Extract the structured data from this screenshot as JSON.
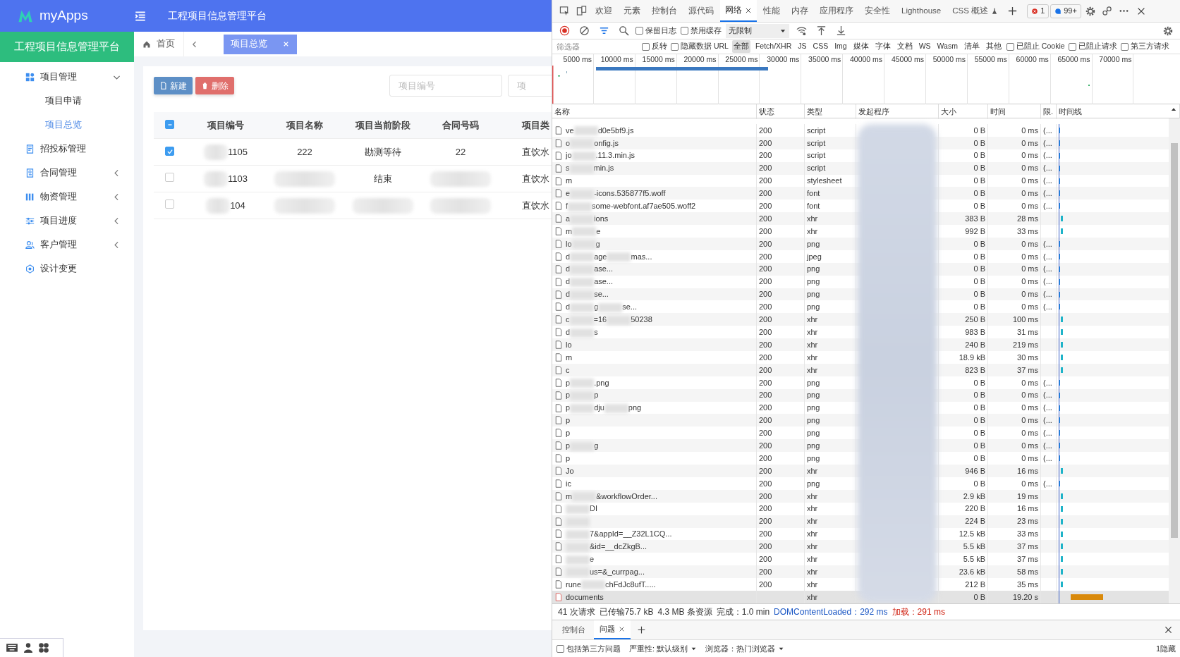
{
  "app": {
    "logo": "myApps",
    "header_title": "工程项目信息管理平台",
    "brand": "工程项目信息管理平台",
    "sidebar": [
      {
        "label": "项目管理",
        "kind": "group",
        "expanded": true,
        "children": [
          {
            "label": "项目申请",
            "selected": false
          },
          {
            "label": "项目总览",
            "selected": true
          }
        ]
      },
      {
        "label": "招投标管理",
        "kind": "link"
      },
      {
        "label": "合同管理",
        "kind": "group",
        "expanded": false
      },
      {
        "label": "物资管理",
        "kind": "group",
        "expanded": false
      },
      {
        "label": "项目进度",
        "kind": "group",
        "expanded": false
      },
      {
        "label": "客户管理",
        "kind": "group",
        "expanded": false
      },
      {
        "label": "设计变更",
        "kind": "link"
      }
    ],
    "tabs": [
      {
        "label": "首页",
        "kind": "home",
        "selected": false
      },
      {
        "label": "项目总览",
        "kind": "closable",
        "selected": true
      }
    ],
    "buttons": [
      {
        "label": "新建",
        "kind": "primary"
      },
      {
        "label": "删除",
        "kind": "danger"
      }
    ],
    "search_fields": [
      {
        "placeholder": "项目编号"
      },
      {
        "placeholder": "项"
      }
    ],
    "table": {
      "header_check": {
        "checked": true,
        "partial": true
      },
      "columns": [
        "项目编号",
        "项目名称",
        "项目当前阶段",
        "合同号码",
        "项目类"
      ],
      "rows": [
        {
          "checked": true,
          "cells": [
            {
              "text": "1105",
              "blurred": true
            },
            {
              "text": "222",
              "blurred": false
            },
            {
              "text": "勘测等待",
              "blurred": false
            },
            {
              "text": "22",
              "blurred": false
            },
            {
              "text": "直饮水",
              "blurred": false
            }
          ]
        },
        {
          "checked": false,
          "cells": [
            {
              "text": "1103",
              "blurred": true
            },
            {
              "blurred": true
            },
            {
              "text": "结束",
              "blurred": false
            },
            {
              "blurred": true
            },
            {
              "text": "直饮水",
              "blurred": false
            }
          ]
        },
        {
          "checked": false,
          "cells": [
            {
              "text": "104",
              "blurred": true
            },
            {
              "blurred": true
            },
            {
              "blurred": true
            },
            {
              "blurred": true
            },
            {
              "text": "直饮水",
              "blurred": false
            }
          ]
        }
      ]
    }
  },
  "devtools": {
    "tabs": [
      {
        "label": "欢迎",
        "selected": false,
        "beta": false
      },
      {
        "label": "元素",
        "selected": false,
        "beta": false
      },
      {
        "label": "控制台",
        "selected": false,
        "beta": false
      },
      {
        "label": "源代码",
        "selected": false,
        "beta": false
      },
      {
        "label": "网络",
        "selected": true,
        "beta": false
      },
      {
        "label": "性能",
        "selected": false,
        "beta": false
      },
      {
        "label": "内存",
        "selected": false,
        "beta": false
      },
      {
        "label": "应用程序",
        "selected": false,
        "beta": false
      },
      {
        "label": "安全性",
        "selected": false,
        "beta": false
      },
      {
        "label": "Lighthouse",
        "selected": false,
        "beta": false
      },
      {
        "label": "CSS 概述",
        "selected": false,
        "beta": true
      }
    ],
    "error_count": "1",
    "message_count": "99+",
    "preserve_log": {
      "label": "保留日志",
      "checked": false
    },
    "disable_cache": {
      "label": "禁用缓存",
      "checked": false
    },
    "throttling": "无限制",
    "filter": {
      "placeholder": "筛选器",
      "options": [
        {
          "label": "反转",
          "checked": false
        },
        {
          "label": "隐藏数据 URL",
          "checked": false
        }
      ],
      "types": [
        {
          "label": "全部",
          "selected": true
        },
        {
          "label": "Fetch/XHR",
          "selected": false
        },
        {
          "label": "JS",
          "selected": false
        },
        {
          "label": "CSS",
          "selected": false
        },
        {
          "label": "Img",
          "selected": false
        },
        {
          "label": "媒体",
          "selected": false
        },
        {
          "label": "字体",
          "selected": false
        },
        {
          "label": "文档",
          "selected": false
        },
        {
          "label": "WS",
          "selected": false
        },
        {
          "label": "Wasm",
          "selected": false
        },
        {
          "label": "清单",
          "selected": false
        },
        {
          "label": "其他",
          "selected": false
        }
      ],
      "extra_options": [
        {
          "label": "已阻止 Cookie",
          "checked": false
        },
        {
          "label": "已阻止请求",
          "checked": false
        },
        {
          "label": "第三方请求",
          "checked": false
        }
      ]
    },
    "overview_ticks": [
      "5000 ms",
      "10000 ms",
      "15000 ms",
      "20000 ms",
      "25000 ms",
      "30000 ms",
      "35000 ms",
      "40000 ms",
      "45000 ms",
      "50000 ms",
      "55000 ms",
      "60000 ms",
      "65000 ms",
      "70000 ms"
    ],
    "columns": [
      "名称",
      "状态",
      "类型",
      "发起程序",
      "大小",
      "时间",
      "限.",
      "时间线"
    ],
    "rows": [
      {
        "name": [
          "ve",
          "d0e5bf9.js"
        ],
        "hidden_start": false,
        "status": "200",
        "type": "script",
        "size": "0 B",
        "time": "0 ms",
        "throttle": "(...",
        "kind": "cached",
        "selected": false
      },
      {
        "name": [
          "o",
          "onfig.js"
        ],
        "hidden_start": false,
        "status": "200",
        "type": "script",
        "size": "0 B",
        "time": "0 ms",
        "throttle": "(...",
        "kind": "cached",
        "selected": false
      },
      {
        "name": [
          "jo",
          ".11.3.min.js"
        ],
        "hidden_start": false,
        "status": "200",
        "type": "script",
        "size": "0 B",
        "time": "0 ms",
        "throttle": "(...",
        "kind": "cached",
        "selected": false
      },
      {
        "name": [
          "s",
          "min.js"
        ],
        "hidden_start": false,
        "status": "200",
        "type": "script",
        "size": "0 B",
        "time": "0 ms",
        "throttle": "(...",
        "kind": "cached",
        "selected": false
      },
      {
        "name": [
          "m"
        ],
        "hidden_start": false,
        "status": "200",
        "type": "stylesheet",
        "size": "0 B",
        "time": "0 ms",
        "throttle": "(...",
        "kind": "cached",
        "selected": false
      },
      {
        "name": [
          "e",
          "-icons.535877f5.woff"
        ],
        "hidden_start": false,
        "status": "200",
        "type": "font",
        "size": "0 B",
        "time": "0 ms",
        "throttle": "(...",
        "kind": "cached",
        "selected": false
      },
      {
        "name": [
          "f",
          "some-webfont.af7ae505.woff2"
        ],
        "hidden_start": false,
        "status": "200",
        "type": "font",
        "size": "0 B",
        "time": "0 ms",
        "throttle": "(...",
        "kind": "cached",
        "selected": false
      },
      {
        "name": [
          "a",
          "ions"
        ],
        "hidden_start": false,
        "status": "200",
        "type": "xhr",
        "size": "383 B",
        "time": "28 ms",
        "kind": "fetched",
        "selected": false
      },
      {
        "name": [
          "m",
          "e"
        ],
        "hidden_start": false,
        "status": "200",
        "type": "xhr",
        "size": "992 B",
        "time": "33 ms",
        "kind": "fetched",
        "selected": false
      },
      {
        "name": [
          "lo",
          "g"
        ],
        "hidden_start": false,
        "status": "200",
        "type": "png",
        "size": "0 B",
        "time": "0 ms",
        "throttle": "(...",
        "kind": "cached",
        "selected": false
      },
      {
        "name": [
          "d",
          "age",
          "mas..."
        ],
        "hidden_start": false,
        "status": "200",
        "type": "jpeg",
        "size": "0 B",
        "time": "0 ms",
        "throttle": "(...",
        "kind": "cached",
        "selected": false
      },
      {
        "name": [
          "d",
          "ase..."
        ],
        "hidden_start": false,
        "status": "200",
        "type": "png",
        "size": "0 B",
        "time": "0 ms",
        "throttle": "(...",
        "kind": "cached",
        "selected": false
      },
      {
        "name": [
          "d",
          "ase..."
        ],
        "hidden_start": false,
        "status": "200",
        "type": "png",
        "size": "0 B",
        "time": "0 ms",
        "throttle": "(...",
        "kind": "cached",
        "selected": false
      },
      {
        "name": [
          "d",
          "se..."
        ],
        "hidden_start": false,
        "status": "200",
        "type": "png",
        "size": "0 B",
        "time": "0 ms",
        "throttle": "(...",
        "kind": "cached",
        "selected": false
      },
      {
        "name": [
          "d",
          "g",
          "se..."
        ],
        "hidden_start": false,
        "status": "200",
        "type": "png",
        "size": "0 B",
        "time": "0 ms",
        "throttle": "(...",
        "kind": "cached",
        "selected": false
      },
      {
        "name": [
          "c",
          "=16",
          "50238"
        ],
        "hidden_start": false,
        "status": "200",
        "type": "xhr",
        "size": "250 B",
        "time": "100 ms",
        "kind": "fetched",
        "selected": false
      },
      {
        "name": [
          "d",
          "s"
        ],
        "hidden_start": false,
        "status": "200",
        "type": "xhr",
        "size": "983 B",
        "time": "31 ms",
        "kind": "fetched",
        "selected": false
      },
      {
        "name": [
          "lo"
        ],
        "hidden_start": false,
        "status": "200",
        "type": "xhr",
        "size": "240 B",
        "time": "219 ms",
        "kind": "fetched",
        "selected": false
      },
      {
        "name": [
          "m"
        ],
        "hidden_start": false,
        "status": "200",
        "type": "xhr",
        "size": "18.9 kB",
        "time": "30 ms",
        "kind": "fetched",
        "selected": false
      },
      {
        "name": [
          "c"
        ],
        "hidden_start": false,
        "status": "200",
        "type": "xhr",
        "size": "823 B",
        "time": "37 ms",
        "kind": "fetched",
        "selected": false
      },
      {
        "name": [
          "p",
          ".png"
        ],
        "hidden_start": false,
        "status": "200",
        "type": "png",
        "size": "0 B",
        "time": "0 ms",
        "throttle": "(...",
        "kind": "cached",
        "selected": false
      },
      {
        "name": [
          "p",
          "p"
        ],
        "hidden_start": false,
        "status": "200",
        "type": "png",
        "size": "0 B",
        "time": "0 ms",
        "throttle": "(...",
        "kind": "cached",
        "selected": false
      },
      {
        "name": [
          "p",
          "dju",
          "png"
        ],
        "hidden_start": false,
        "status": "200",
        "type": "png",
        "size": "0 B",
        "time": "0 ms",
        "throttle": "(...",
        "kind": "cached",
        "selected": false
      },
      {
        "name": [
          "p"
        ],
        "hidden_start": false,
        "status": "200",
        "type": "png",
        "size": "0 B",
        "time": "0 ms",
        "throttle": "(...",
        "kind": "cached",
        "selected": false
      },
      {
        "name": [
          "p"
        ],
        "hidden_start": false,
        "status": "200",
        "type": "png",
        "size": "0 B",
        "time": "0 ms",
        "throttle": "(...",
        "kind": "cached",
        "selected": false
      },
      {
        "name": [
          "p",
          "g"
        ],
        "hidden_start": false,
        "status": "200",
        "type": "png",
        "size": "0 B",
        "time": "0 ms",
        "throttle": "(...",
        "kind": "cached",
        "selected": false
      },
      {
        "name": [
          "p"
        ],
        "hidden_start": false,
        "status": "200",
        "type": "png",
        "size": "0 B",
        "time": "0 ms",
        "throttle": "(...",
        "kind": "cached",
        "selected": false
      },
      {
        "name": [
          "Jo"
        ],
        "hidden_start": false,
        "status": "200",
        "type": "xhr",
        "size": "946 B",
        "time": "16 ms",
        "kind": "fetched",
        "selected": false
      },
      {
        "name": [
          "ic"
        ],
        "hidden_start": false,
        "status": "200",
        "type": "png",
        "size": "0 B",
        "time": "0 ms",
        "throttle": "(...",
        "kind": "cached",
        "selected": false
      },
      {
        "name": [
          "m",
          "&workflowOrder..."
        ],
        "hidden_start": false,
        "status": "200",
        "type": "xhr",
        "size": "2.9 kB",
        "time": "19 ms",
        "kind": "fetched",
        "selected": false
      },
      {
        "name": [
          "DI"
        ],
        "hidden_start": true,
        "status": "200",
        "type": "xhr",
        "size": "220 B",
        "time": "16 ms",
        "kind": "fetched",
        "selected": false
      },
      {
        "hidden_start": true,
        "status": "200",
        "type": "xhr",
        "size": "224 B",
        "time": "23 ms",
        "kind": "fetched",
        "selected": false
      },
      {
        "name": [
          "7&appId=__Z32L1CQ..."
        ],
        "hidden_start": true,
        "status": "200",
        "type": "xhr",
        "size": "12.5 kB",
        "time": "33 ms",
        "kind": "fetched",
        "selected": false
      },
      {
        "name": [
          "&id=__dcZkgB..."
        ],
        "hidden_start": true,
        "status": "200",
        "type": "xhr",
        "size": "5.5 kB",
        "time": "37 ms",
        "kind": "fetched",
        "selected": false
      },
      {
        "name": [
          "e"
        ],
        "hidden_start": true,
        "status": "200",
        "type": "xhr",
        "size": "5.5 kB",
        "time": "37 ms",
        "kind": "fetched",
        "selected": false
      },
      {
        "name": [
          "us=&_currpag..."
        ],
        "hidden_start": true,
        "status": "200",
        "type": "xhr",
        "size": "23.6 kB",
        "time": "58 ms",
        "kind": "fetched",
        "selected": false
      },
      {
        "name": [
          "rune",
          "chFdJc8ufT....."
        ],
        "hidden_start": false,
        "status": "200",
        "type": "xhr",
        "size": "212 B",
        "time": "35 ms",
        "kind": "fetched",
        "selected": false
      },
      {
        "name": [
          "documents"
        ],
        "hidden_start": false,
        "type": "xhr",
        "size": "0 B",
        "time": "19.20 s",
        "kind": "pending",
        "selected": true
      }
    ],
    "summary": [
      {
        "text": "41 次请求"
      },
      {
        "text": "已传输75.7 kB"
      },
      {
        "text": "4.3 MB 条资源"
      },
      {
        "text": "完成：1.0 min"
      },
      {
        "text": "DOMContentLoaded：292 ms",
        "color": "#1a56c4"
      },
      {
        "text": "加载：291 ms",
        "color": "#d02010"
      }
    ],
    "drawer_tabs": [
      {
        "label": "控制台",
        "selected": false
      },
      {
        "label": "问题",
        "selected": true
      }
    ],
    "issues": {
      "third_party": {
        "label": "包括第三方问题",
        "checked": false
      },
      "severity": "严重性: 默认级别",
      "browsers": "浏览器：热门浏览器",
      "hidden_count": "1隐藏"
    }
  }
}
